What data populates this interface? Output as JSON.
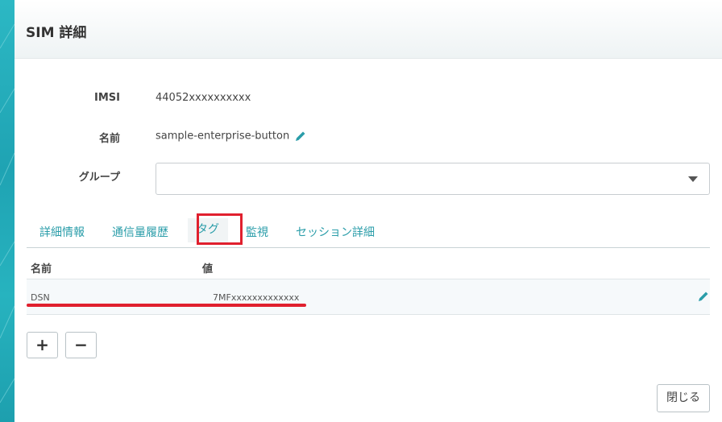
{
  "dialog": {
    "title": "SIM 詳細"
  },
  "fields": {
    "imsi": {
      "label": "IMSI",
      "value": "44052xxxxxxxxxx"
    },
    "name": {
      "label": "名前",
      "value": "sample-enterprise-button"
    },
    "group": {
      "label": "グループ",
      "selected": ""
    }
  },
  "tabs": [
    "詳細情報",
    "通信量履歴",
    "タグ",
    "監視",
    "セッション詳細"
  ],
  "active_tab": "タグ",
  "table": {
    "headers": {
      "name": "名前",
      "value": "値"
    },
    "rows": [
      {
        "name": "DSN",
        "value": "7MFxxxxxxxxxxxxx"
      }
    ]
  },
  "buttons": {
    "add": "+",
    "remove": "−",
    "close": "閉じる"
  },
  "colors": {
    "accent": "#2a9da9",
    "highlight": "#e0202e"
  },
  "icons": {
    "edit": "pencil-icon",
    "dropdown": "caret-down-icon"
  }
}
